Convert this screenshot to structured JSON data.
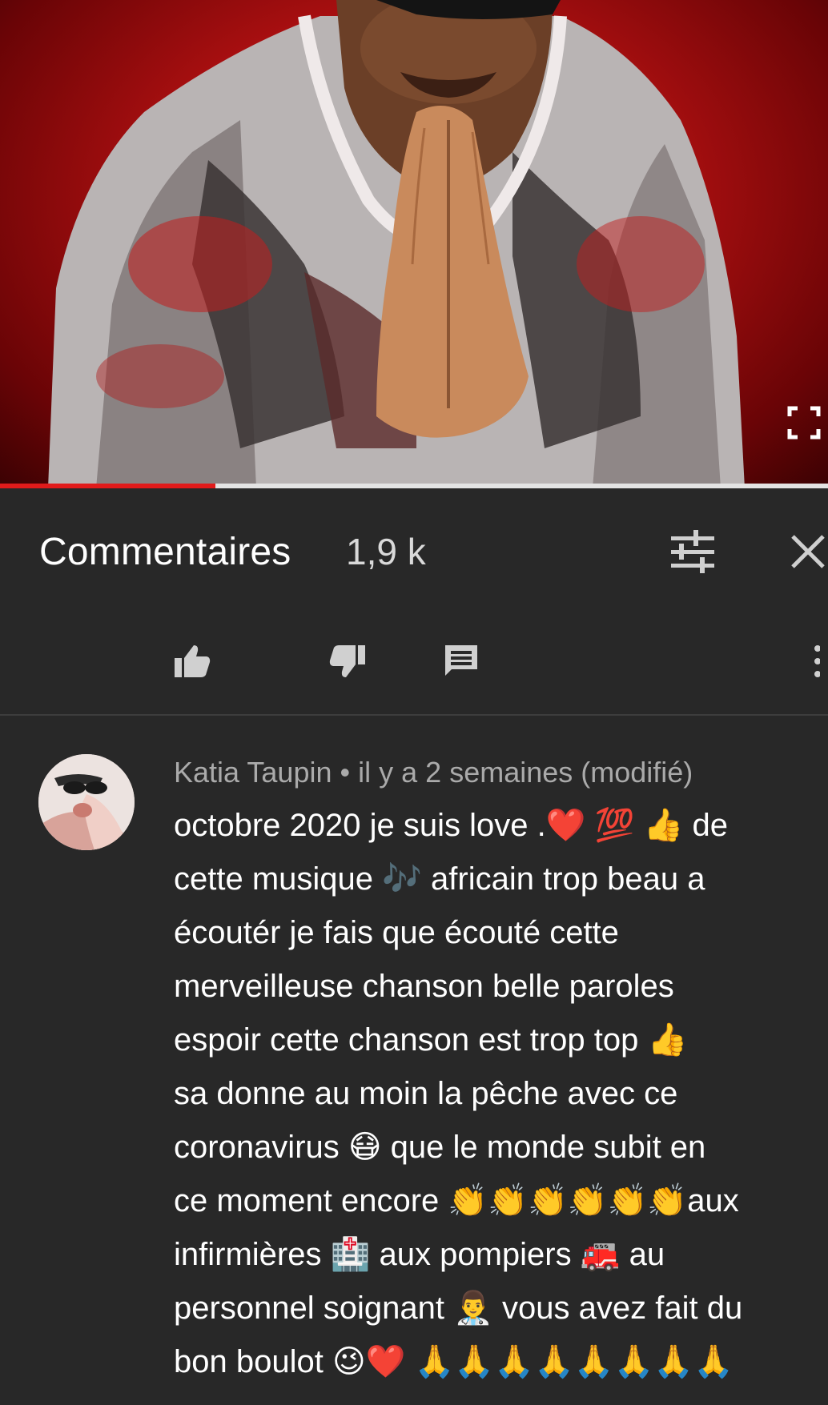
{
  "video": {
    "progress_fraction": 0.26
  },
  "comments_panel": {
    "title": "Commentaires",
    "count": "1,9 k",
    "sort_icon": "tune-sliders-icon",
    "close_icon": "close-icon"
  },
  "actions": {
    "like_icon": "thumbs-up-icon",
    "dislike_icon": "thumbs-down-icon",
    "reply_icon": "comment-icon",
    "more_icon": "more-vert-icon"
  },
  "comment": {
    "author": "Katia Taupin",
    "separator": "•",
    "time": "il y a 2 semaines (modifié)",
    "lines": [
      "octobre 2020  je suis love .❤️ 💯 👍 de",
      "cette musique 🎶 africain trop beau a",
      "écoutér  je fais que écouté cette",
      "merveilleuse chanson belle paroles",
      "espoir  cette chanson est trop top  👍",
      "sa donne au moin  la pêche avec ce",
      "coronavirus 😷 que le monde subit en",
      "ce moment encore 👏👏👏👏👏👏aux",
      "infirmières 🏥 aux pompiers 🚒 au",
      "personnel soignant 👨‍⚕️ vous avez fait du",
      "bon boulot 😉❤️ 🙏🙏🙏🙏🙏🙏🙏🙏"
    ]
  },
  "colors": {
    "background": "#282828",
    "progress_red": "#e11b1b",
    "meta_gray": "#aaaaaa"
  }
}
